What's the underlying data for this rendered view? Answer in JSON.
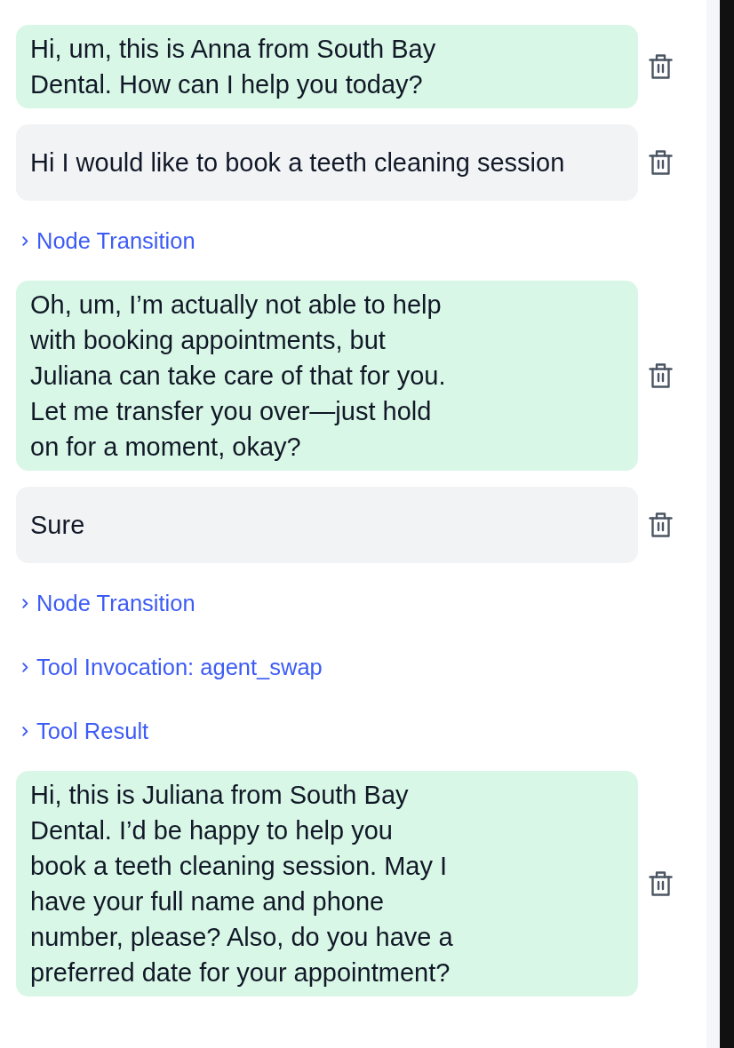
{
  "messages": [
    {
      "kind": "agent_message",
      "text": "Hi, um, this is Anna from South Bay Dental. How can I help you today?"
    },
    {
      "kind": "user_message",
      "text": "Hi I would like to book a teeth cleaning session"
    },
    {
      "kind": "event",
      "label": "Node Transition",
      "expanded": false
    },
    {
      "kind": "agent_message",
      "text": "Oh, um, I’m actually not able to help with booking appointments, but Juliana can take care of that for you. Let me transfer you over—just hold on for a moment, okay?"
    },
    {
      "kind": "user_message",
      "text": "Sure"
    },
    {
      "kind": "event",
      "label": "Node Transition",
      "expanded": false
    },
    {
      "kind": "event",
      "label": "Tool Invocation: agent_swap",
      "expanded": false
    },
    {
      "kind": "event",
      "label": "Tool Result",
      "expanded": false
    },
    {
      "kind": "agent_message",
      "text": "Hi, this is Juliana from South Bay Dental. I’d be happy to help you book a teeth cleaning session. May I have your full name and phone number, please? Also, do you have a preferred date for your appointment?"
    }
  ]
}
